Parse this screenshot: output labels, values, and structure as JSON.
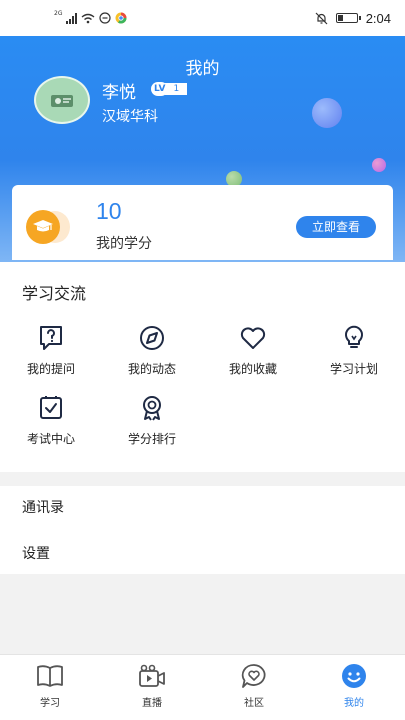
{
  "status_bar": {
    "network": "2G",
    "time": "2:04"
  },
  "header": {
    "title": "我的"
  },
  "profile": {
    "name": "李悦",
    "level_badge": "LV",
    "level": "1",
    "organization": "汉域华科"
  },
  "credits": {
    "value": "10",
    "label": "我的学分",
    "view_button": "立即查看"
  },
  "learning_exchange": {
    "title": "学习交流",
    "items": [
      {
        "label": "我的提问",
        "icon": "question-icon"
      },
      {
        "label": "我的动态",
        "icon": "compass-icon"
      },
      {
        "label": "我的收藏",
        "icon": "heart-icon"
      },
      {
        "label": "学习计划",
        "icon": "lightbulb-icon"
      },
      {
        "label": "考试中心",
        "icon": "exam-check-icon"
      },
      {
        "label": "学分排行",
        "icon": "award-ribbon-icon"
      }
    ]
  },
  "menu": {
    "contacts": "通讯录",
    "settings": "设置"
  },
  "tab_bar": {
    "tabs": [
      {
        "label": "学习",
        "icon": "book-icon",
        "active": false
      },
      {
        "label": "直播",
        "icon": "video-camera-icon",
        "active": false
      },
      {
        "label": "社区",
        "icon": "chat-heart-icon",
        "active": false
      },
      {
        "label": "我的",
        "icon": "smiley-icon",
        "active": true
      }
    ]
  },
  "colors": {
    "primary": "#2f84ec",
    "credit_icon": "#f6a623",
    "avatar_bg": "#a9d9b6"
  }
}
